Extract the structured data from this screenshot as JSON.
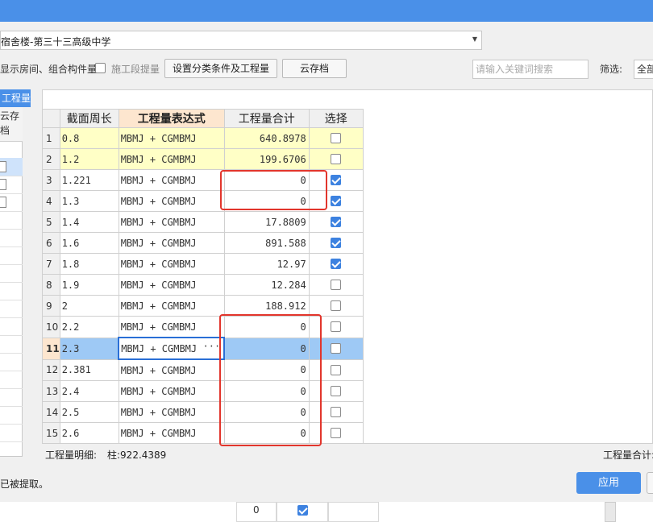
{
  "header": {
    "combo_value": "宿舍楼-第三十三高级中学",
    "show_room_label": "显示房间、组合构件量",
    "construction_stage_label": "施工段提量",
    "set_conditions_button": "设置分类条件及工程量",
    "cloud_save_button": "云存档",
    "search_placeholder": "请输入关键词搜索",
    "filter_label": "筛选:",
    "filter_value": "全部"
  },
  "left_panel": {
    "tab_label": "工程量",
    "col_header": "云存档"
  },
  "grid": {
    "columns": [
      "截面周长",
      "工程量表达式",
      "工程量合计",
      "选择"
    ],
    "rows": [
      {
        "n": "1",
        "perimeter": "0.8",
        "expr": "MBMJ + CGMBMJ",
        "total": "640.8978",
        "checked": false
      },
      {
        "n": "2",
        "perimeter": "1.2",
        "expr": "MBMJ + CGMBMJ",
        "total": "199.6706",
        "checked": false
      },
      {
        "n": "3",
        "perimeter": "1.221",
        "expr": "MBMJ + CGMBMJ",
        "total": "0",
        "checked": true
      },
      {
        "n": "4",
        "perimeter": "1.3",
        "expr": "MBMJ + CGMBMJ",
        "total": "0",
        "checked": true
      },
      {
        "n": "5",
        "perimeter": "1.4",
        "expr": "MBMJ + CGMBMJ",
        "total": "17.8809",
        "checked": true
      },
      {
        "n": "6",
        "perimeter": "1.6",
        "expr": "MBMJ + CGMBMJ",
        "total": "891.588",
        "checked": true
      },
      {
        "n": "7",
        "perimeter": "1.8",
        "expr": "MBMJ + CGMBMJ",
        "total": "12.97",
        "checked": true
      },
      {
        "n": "8",
        "perimeter": "1.9",
        "expr": "MBMJ + CGMBMJ",
        "total": "12.284",
        "checked": false
      },
      {
        "n": "9",
        "perimeter": "2",
        "expr": "MBMJ + CGMBMJ",
        "total": "188.912",
        "checked": false
      },
      {
        "n": "10",
        "perimeter": "2.2",
        "expr": "MBMJ + CGMBMJ",
        "total": "0",
        "checked": false
      },
      {
        "n": "11",
        "perimeter": "2.3",
        "expr": "MBMJ + CGMBMJ",
        "total": "0",
        "checked": false
      },
      {
        "n": "12",
        "perimeter": "2.381",
        "expr": "MBMJ + CGMBMJ",
        "total": "0",
        "checked": false
      },
      {
        "n": "13",
        "perimeter": "2.4",
        "expr": "MBMJ + CGMBMJ",
        "total": "0",
        "checked": false
      },
      {
        "n": "14",
        "perimeter": "2.5",
        "expr": "MBMJ + CGMBMJ",
        "total": "0",
        "checked": false
      },
      {
        "n": "15",
        "perimeter": "2.6",
        "expr": "MBMJ + CGMBMJ",
        "total": "0",
        "checked": false
      }
    ],
    "ellipsis": "···"
  },
  "footer": {
    "detail_label": "工程量明细:",
    "detail_value": "柱:922.4389",
    "total_label": "工程量合计:",
    "status_text": "已被提取。",
    "apply_button": "应用"
  },
  "under": {
    "value": "0"
  },
  "colors": {
    "accent": "#4a90e8",
    "highlight_red": "#e2352c",
    "selected_row": "#9ec9f5",
    "yellow_row": "#ffffc6"
  }
}
